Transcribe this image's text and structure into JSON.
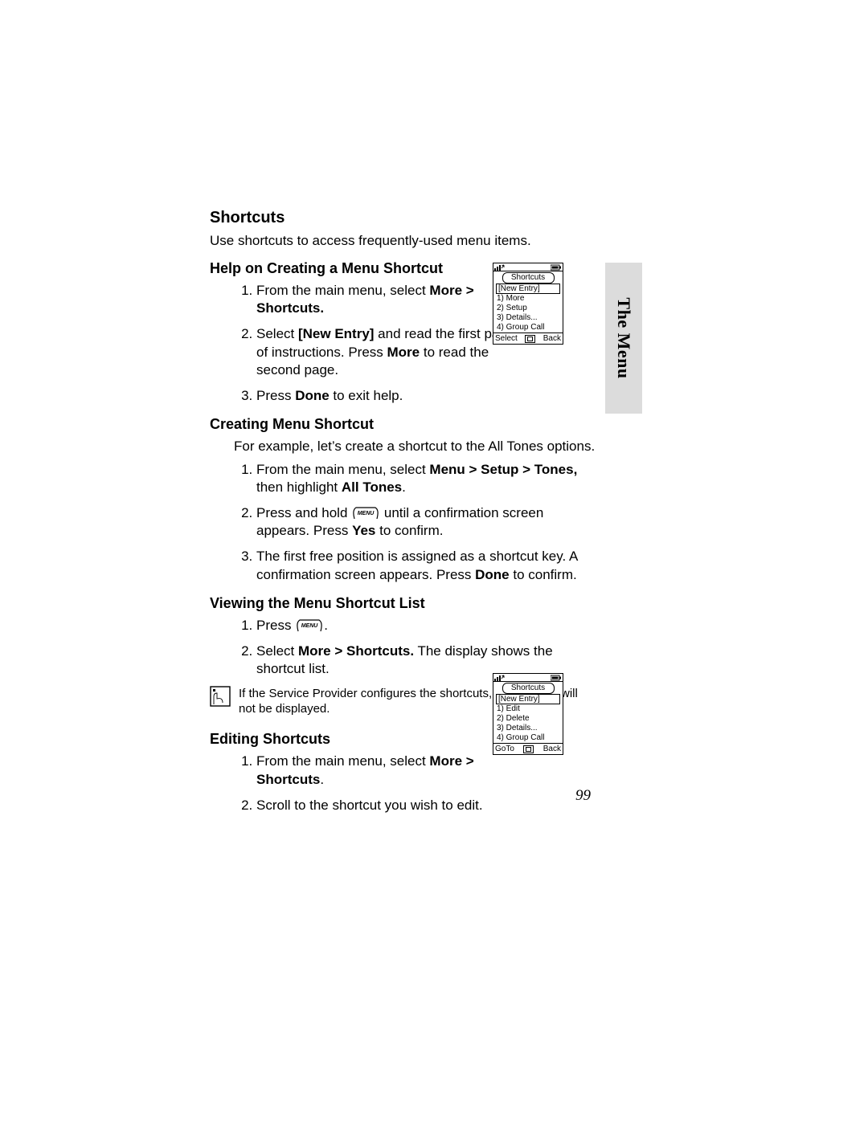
{
  "side_tab": "The Menu",
  "page_number": "99",
  "section_title": "Shortcuts",
  "intro": "Use shortcuts to access frequently-used menu items.",
  "help": {
    "heading": "Help on Creating a Menu Shortcut",
    "step1_a": "From the main menu, select ",
    "step1_b": "More > Shortcuts.",
    "step2_a": "Select ",
    "step2_b": "[New Entry]",
    "step2_c": " and read the first page of instructions. Press ",
    "step2_d": "More",
    "step2_e": " to read the second page.",
    "step3_a": "Press ",
    "step3_b": "Done",
    "step3_c": " to exit help."
  },
  "create": {
    "heading": "Creating Menu Shortcut",
    "intro": "For example, let’s create a shortcut to the All Tones options.",
    "step1_a": "From the main menu, select ",
    "step1_b": "Menu > Setup > Tones,",
    "step1_c": " then highlight ",
    "step1_d": "All Tones",
    "step1_e": ".",
    "step2_a": "Press and hold ",
    "step2_b": " until a confirmation screen appears. Press ",
    "step2_c": "Yes",
    "step2_d": " to confirm.",
    "step3_a": "The first free position is assigned as a shortcut key. A confirmation screen appears. Press ",
    "step3_b": "Done",
    "step3_c": " to confirm."
  },
  "view": {
    "heading": "Viewing the Menu Shortcut List",
    "step1_a": "Press ",
    "step1_b": ".",
    "step2_a": "Select ",
    "step2_b": "More > Shortcuts.",
    "step2_c": " The display shows the shortcut list."
  },
  "note": "If the Service Provider configures the shortcuts, [New Entry] will not be displayed.",
  "edit": {
    "heading": "Editing Shortcuts",
    "step1_a": "From the main menu, select ",
    "step1_b": "More > Shortcuts",
    "step1_c": ".",
    "step2": "Scroll to the shortcut you wish to edit."
  },
  "phone1": {
    "title": "Shortcuts",
    "highlight": "[New Entry]",
    "r1": "1) More",
    "r2": "2) Setup",
    "r3": "3) Details...",
    "r4": "4) Group Call",
    "sk_left": "Select",
    "sk_right": "Back"
  },
  "phone2": {
    "title": "Shortcuts",
    "highlight": "[New Entry]",
    "r1": "1) Edit",
    "r2": "2) Delete",
    "r3": "3) Details...",
    "r4": "4) Group Call",
    "sk_left": "GoTo",
    "sk_right": "Back"
  },
  "menu_key_label": "MENU"
}
